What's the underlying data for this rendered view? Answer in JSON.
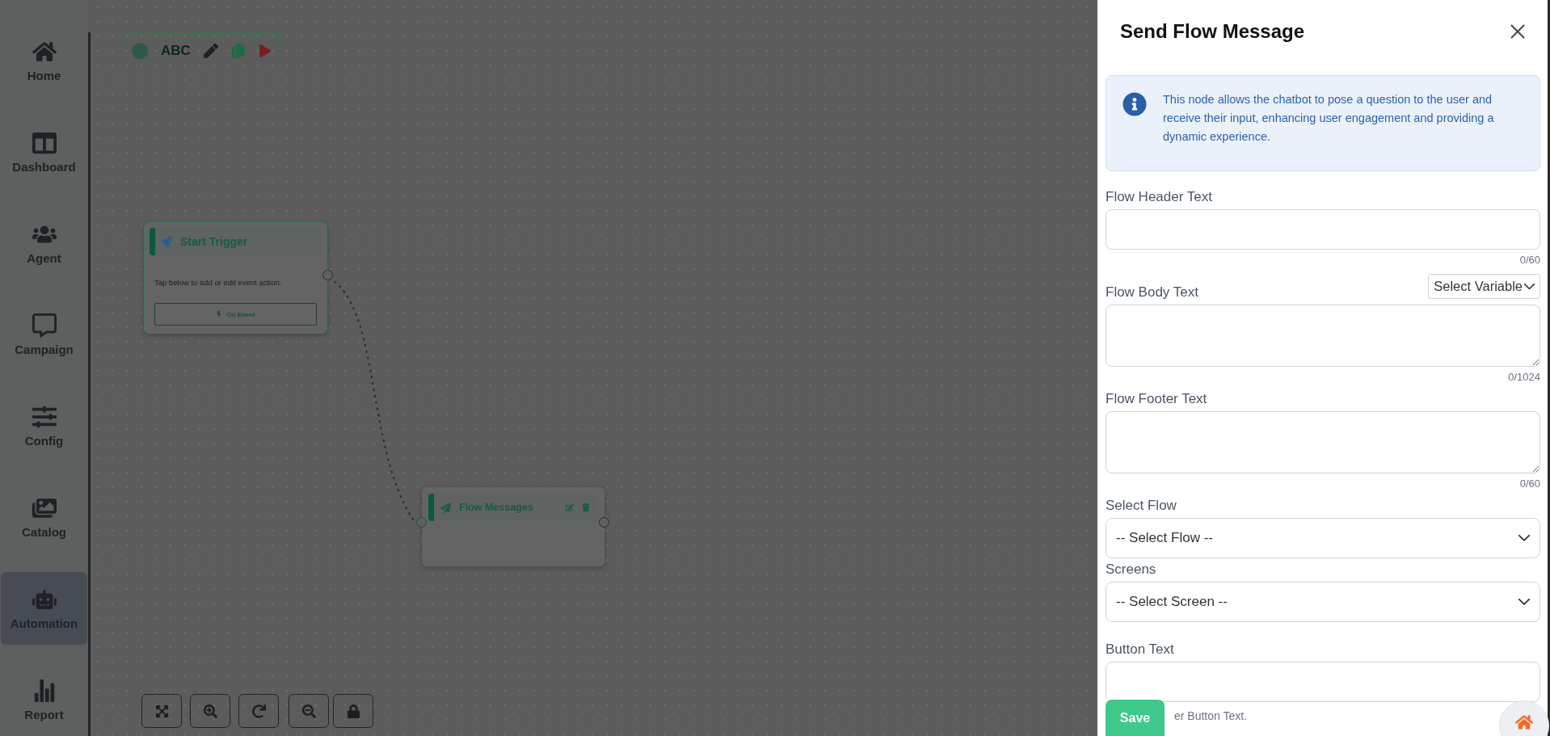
{
  "sidebar": {
    "items": [
      {
        "label": "Home",
        "selected": false
      },
      {
        "label": "Dashboard",
        "selected": false
      },
      {
        "label": "Agent",
        "selected": false
      },
      {
        "label": "Campaign",
        "selected": false
      },
      {
        "label": "Config",
        "selected": false
      },
      {
        "label": "Catalog",
        "selected": false
      },
      {
        "label": "Automation",
        "selected": true
      },
      {
        "label": "Report",
        "selected": false
      }
    ]
  },
  "canvas": {
    "toolbar": {
      "label": "ABC"
    },
    "nodes": [
      {
        "kind": "trigger",
        "title": "Start Trigger",
        "description": "Tap below to add or edit event action.",
        "button": "On Event"
      },
      {
        "kind": "message",
        "title": "Flow Messages"
      }
    ]
  },
  "panel": {
    "title": "Send Flow Message",
    "info": "This node allows the chatbot to pose a question to the user and receive their input, enhancing user engagement and providing a dynamic experience.",
    "fields": [
      {
        "kind": "text",
        "label": "Flow Header Text",
        "counter": "0/60"
      },
      {
        "kind": "textarea",
        "label": "Flow Body Text",
        "counter": "0/1024",
        "variable_select": "Select Variable"
      },
      {
        "kind": "textarea",
        "label": "Flow Footer Text",
        "counter": "0/60"
      },
      {
        "kind": "select",
        "label": "Select Flow",
        "value": "-- Select Flow --"
      },
      {
        "kind": "select",
        "label": "Screens",
        "value": "-- Select Screen --"
      },
      {
        "kind": "text",
        "label": "Button Text",
        "helper": "er Button Text."
      }
    ],
    "save_button": "Save"
  }
}
